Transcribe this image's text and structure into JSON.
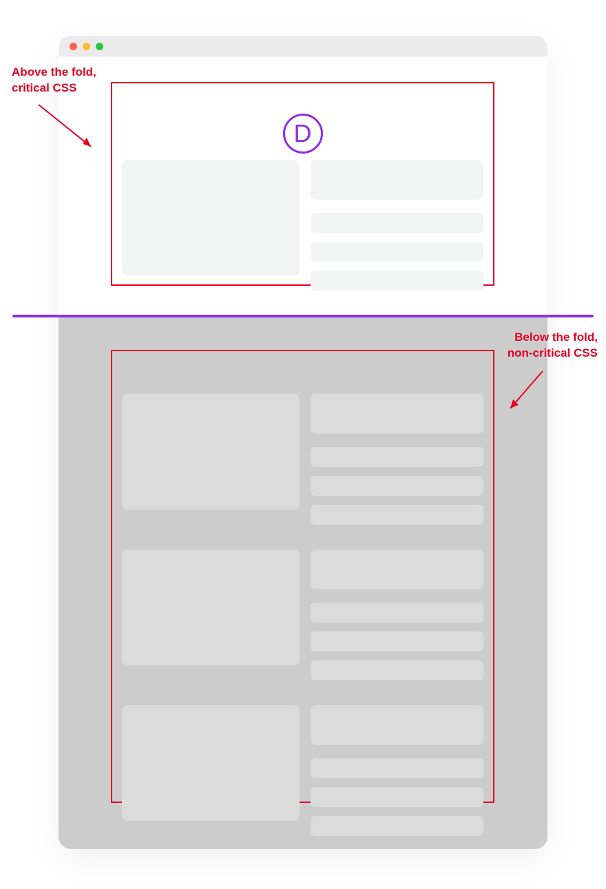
{
  "annotations": {
    "above_line1": "Above the fold,",
    "above_line2": "critical CSS",
    "below_line1": "Below the fold,",
    "below_line2": "non-critical CSS"
  },
  "logo": {
    "letter": "D"
  },
  "colors": {
    "accent_purple": "#8e2de2",
    "annotation_red": "#e60023",
    "above_fold_bg": "#ffffff",
    "below_fold_bg": "#cccccc",
    "placeholder_light": "#f3f4f4",
    "placeholder_dark": "#dbdbdb"
  }
}
